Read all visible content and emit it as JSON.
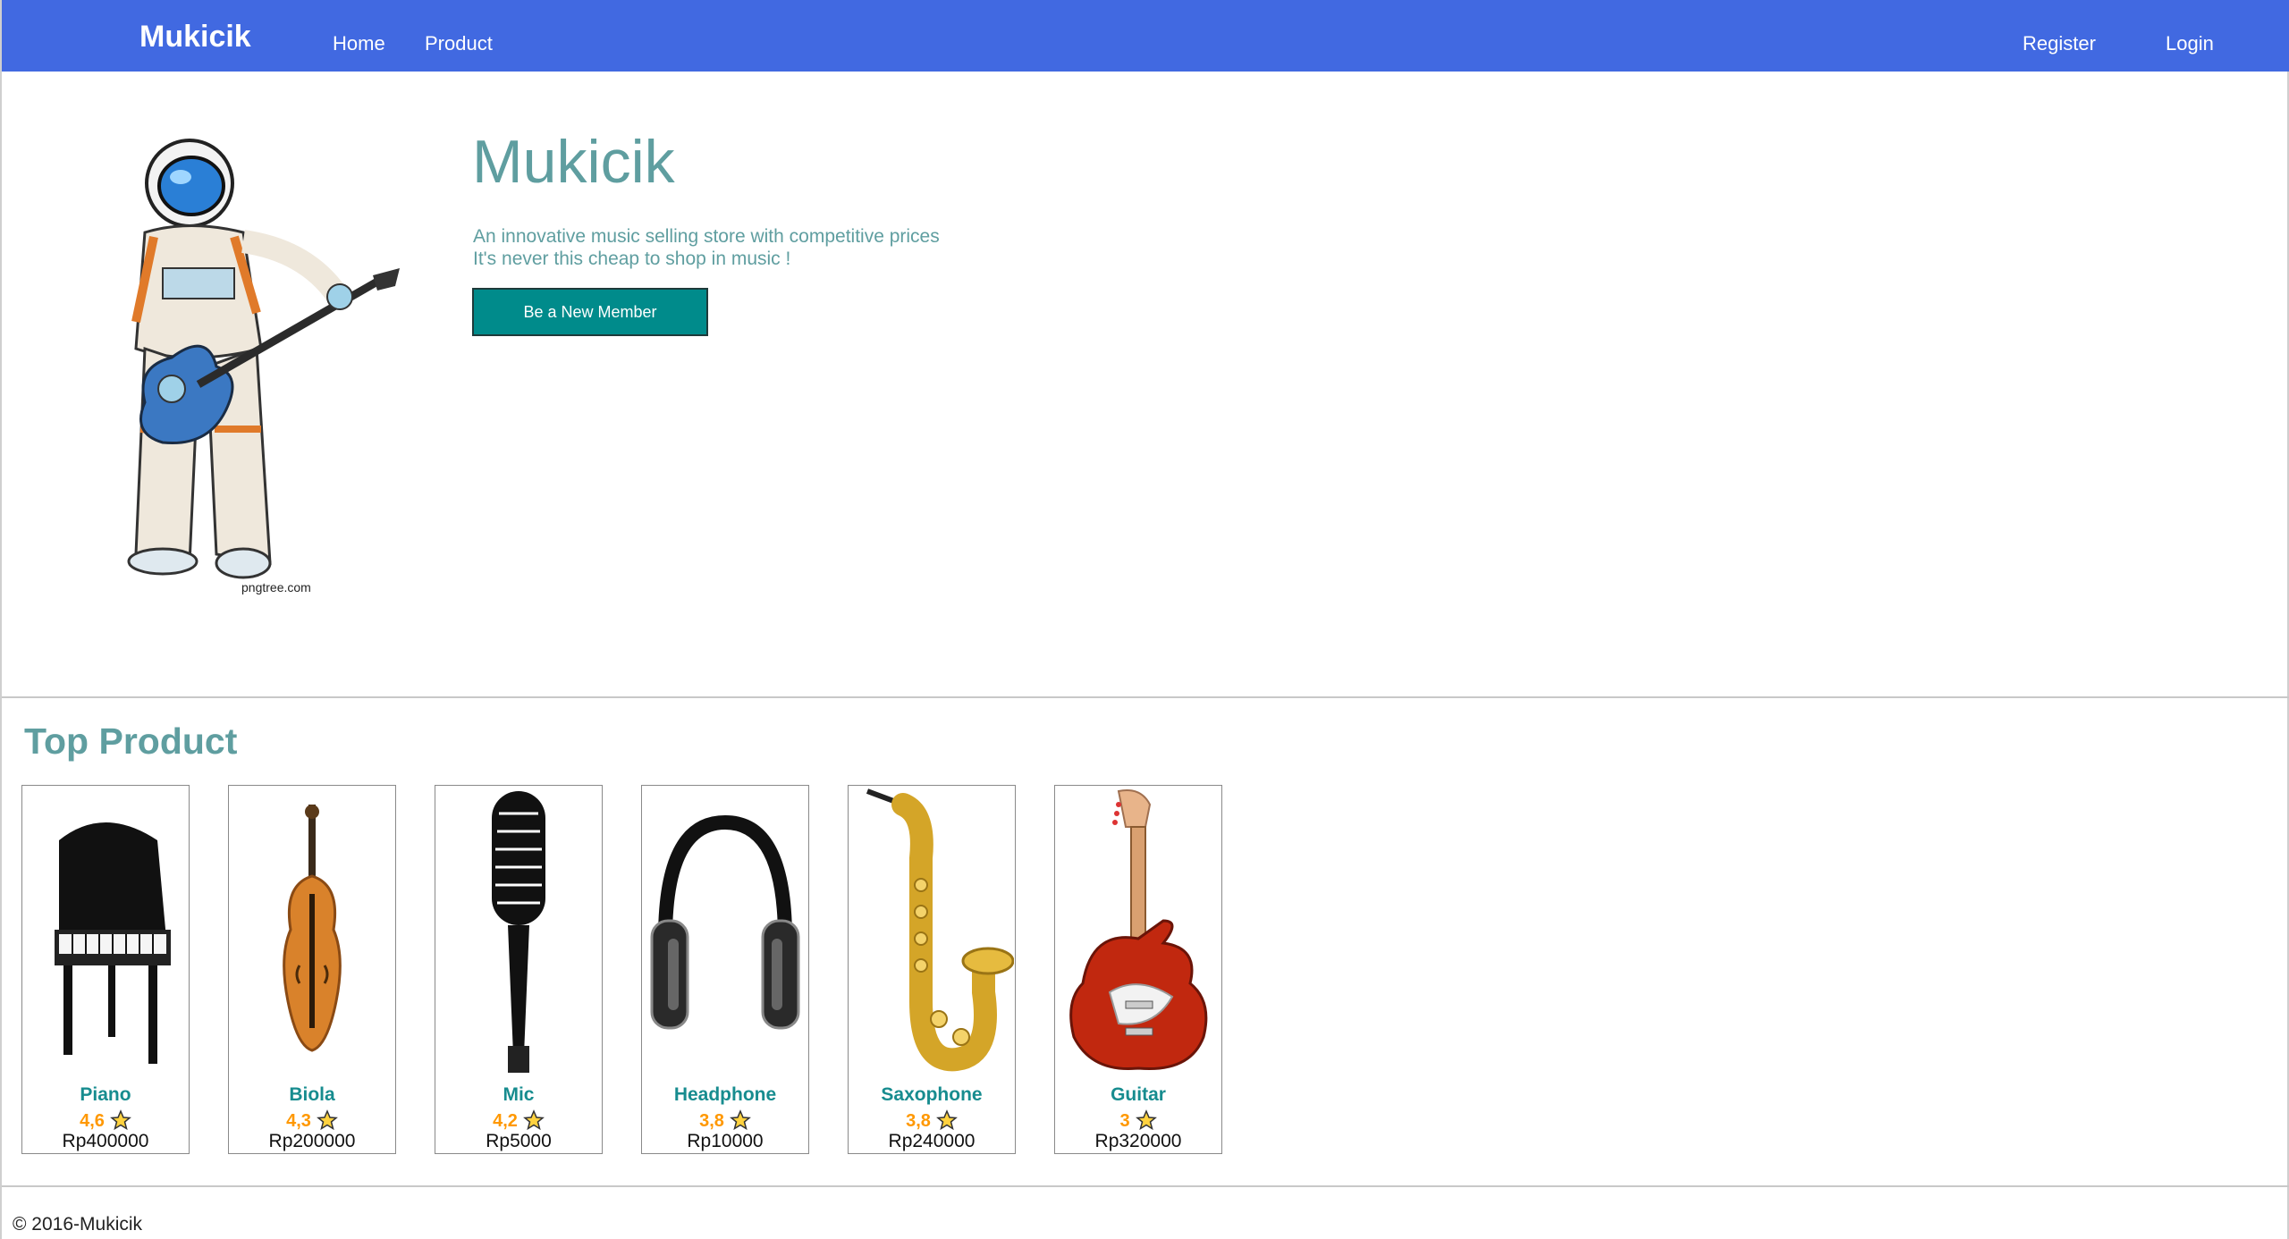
{
  "navbar": {
    "brand": "Mukicik",
    "links": [
      "Home",
      "Product"
    ],
    "register": "Register",
    "login": "Login"
  },
  "hero": {
    "image_icon": "astronaut-guitar-icon",
    "image_caption": "pngtree.com",
    "title": "Mukicik",
    "line1": "An innovative music selling store with competitive prices",
    "line2": "It's never this cheap to shop in music !",
    "button": "Be a New Member"
  },
  "top_product": {
    "title": "Top Product",
    "items": [
      {
        "name": "Piano",
        "rating": "4,6",
        "price": "Rp400000",
        "icon": "piano-icon"
      },
      {
        "name": "Biola",
        "rating": "4,3",
        "price": "Rp200000",
        "icon": "violin-icon"
      },
      {
        "name": "Mic",
        "rating": "4,2",
        "price": "Rp5000",
        "icon": "microphone-icon"
      },
      {
        "name": "Headphone",
        "rating": "3,8",
        "price": "Rp10000",
        "icon": "headphone-icon"
      },
      {
        "name": "Saxophone",
        "rating": "3,8",
        "price": "Rp240000",
        "icon": "saxophone-icon"
      },
      {
        "name": "Guitar",
        "rating": "3",
        "price": "Rp320000",
        "icon": "guitar-icon"
      }
    ]
  },
  "footer": {
    "text": "© 2016-Mukicik"
  },
  "colors": {
    "navbar": "#4169e1",
    "accent": "#5f9ea0",
    "button": "#008b8b",
    "rating": "#ff9800"
  }
}
